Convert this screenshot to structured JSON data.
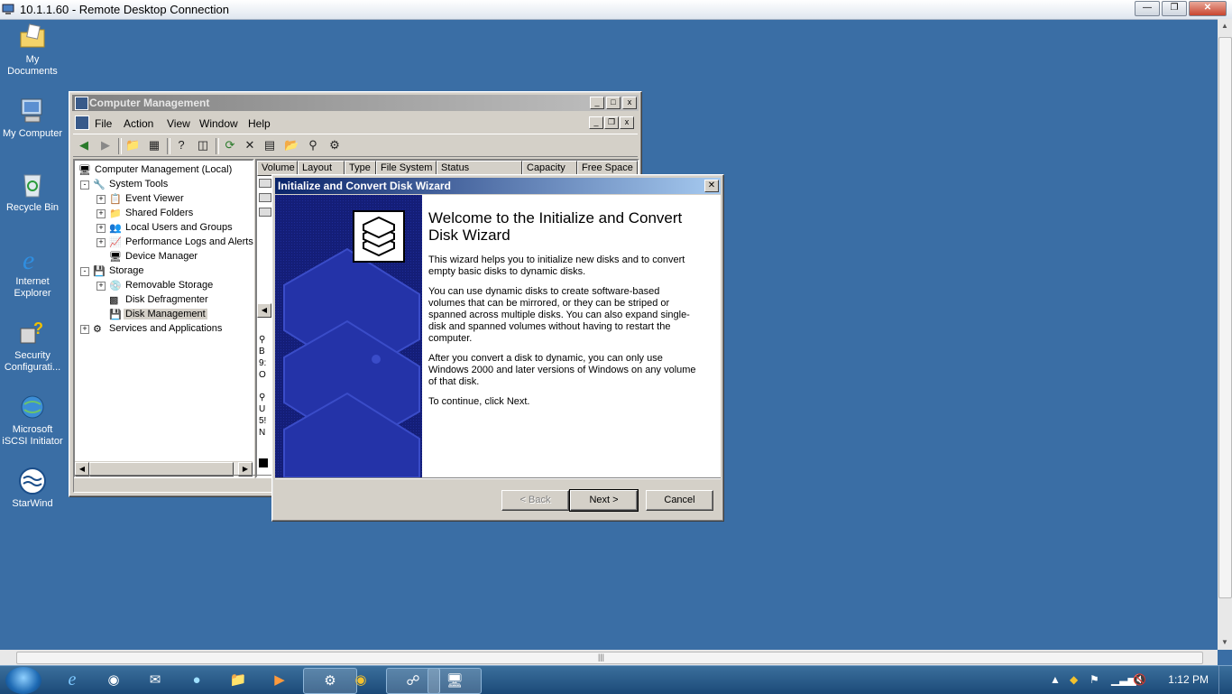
{
  "rdp": {
    "title": "10.1.1.60 - Remote Desktop Connection"
  },
  "desktop_icons": [
    {
      "label": "My Documents",
      "icon": "folder-documents-icon"
    },
    {
      "label": "My Computer",
      "icon": "computer-icon"
    },
    {
      "label": "Recycle Bin",
      "icon": "recycle-bin-icon"
    },
    {
      "label": "Internet Explorer",
      "icon": "internet-explorer-icon"
    },
    {
      "label": "Security Configurati...",
      "icon": "security-config-icon"
    },
    {
      "label": "Microsoft iSCSI Initiator",
      "icon": "iscsi-initiator-icon"
    },
    {
      "label": "StarWind",
      "icon": "starwind-icon"
    }
  ],
  "computer_management": {
    "title": "Computer Management",
    "menu": [
      "File",
      "Action",
      "View",
      "Window",
      "Help"
    ],
    "tree": {
      "root": "Computer Management (Local)",
      "system_tools": "System Tools",
      "event_viewer": "Event Viewer",
      "shared_folders": "Shared Folders",
      "local_users": "Local Users and Groups",
      "perf_logs": "Performance Logs and Alerts",
      "device_manager": "Device Manager",
      "storage": "Storage",
      "removable_storage": "Removable Storage",
      "disk_defrag": "Disk Defragmenter",
      "disk_management": "Disk Management",
      "services_apps": "Services and Applications"
    },
    "columns": [
      "Volume",
      "Layout",
      "Type",
      "File System",
      "Status",
      "Capacity",
      "Free Space"
    ],
    "partial_lines": {
      "disk0": [
        "B",
        "9:",
        "O"
      ],
      "disk1": [
        "U",
        "5!",
        "N"
      ]
    }
  },
  "wizard": {
    "title": "Initialize and Convert Disk Wizard",
    "heading": "Welcome to the Initialize and Convert Disk Wizard",
    "p1": "This wizard helps you to initialize new disks and to convert empty basic disks to dynamic disks.",
    "p2": "You can use dynamic disks to create software-based volumes that can be mirrored, or they can be striped or spanned across multiple disks. You can also expand single-disk and spanned volumes without having to restart the computer.",
    "p3": "After you convert a disk to dynamic, you can only use Windows 2000 and later versions of Windows on any volume of that disk.",
    "p4": "To continue, click Next.",
    "back": "< Back",
    "next": "Next >",
    "cancel": "Cancel"
  },
  "taskbar": {
    "clock": "1:12 PM"
  }
}
